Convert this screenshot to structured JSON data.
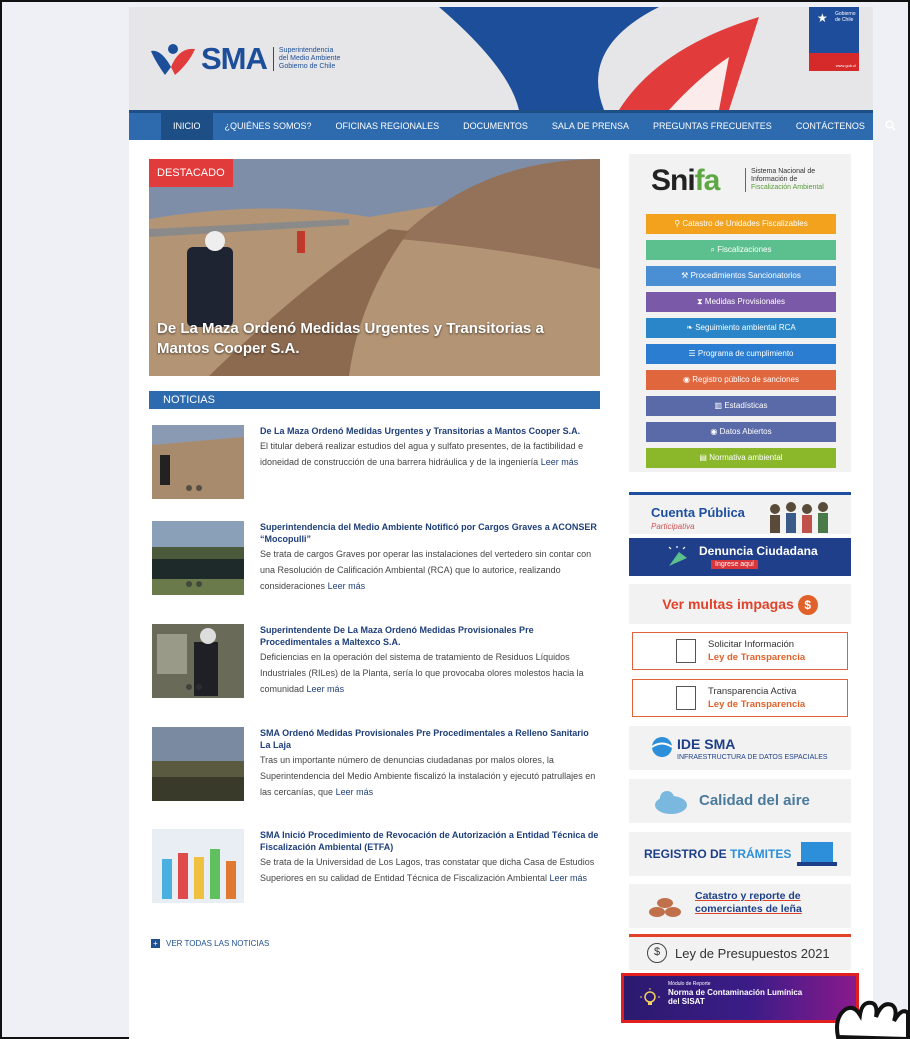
{
  "header": {
    "logo_text": "SMA",
    "logo_sub": [
      "Superintendencia",
      "del Medio Ambiente",
      "Gobierno de Chile"
    ],
    "gobierno": [
      "Gobierno",
      "de Chile"
    ],
    "gobierno_url": "www.gob.cl"
  },
  "nav": {
    "items": [
      "INICIO",
      "¿QUIÉNES SOMOS?",
      "OFICINAS REGIONALES",
      "DOCUMENTOS",
      "SALA DE PRENSA",
      "PREGUNTAS FRECUENTES",
      "CONTÁCTENOS"
    ],
    "search_icon": "search-icon"
  },
  "featured": {
    "badge": "DESTACADO",
    "title": "De La Maza Ordenó Medidas Urgentes y Transitorias a Mantos Cooper S.A."
  },
  "news": {
    "header": "NOTICIAS",
    "read_more": "Leer más",
    "items": [
      {
        "title": "De La Maza Ordenó Medidas Urgentes y Transitorias a Mantos Cooper S.A.",
        "body": "El titular deberá realizar estudios del agua y sulfato presentes, de la factibilidad e idoneidad de construcción de una barrera hidráulica y de la ingeniería"
      },
      {
        "title": "Superintendencia del Medio Ambiente Notificó por Cargos Graves a ACONSER “Mocopulli”",
        "body": "Se trata de cargos Graves por operar las instalaciones del vertedero sin contar con una Resolución de Calificación Ambiental (RCA) que lo autorice, realizando consideraciones"
      },
      {
        "title": "Superintendente De La Maza Ordenó Medidas Provisionales Pre Procedimentales a Maltexco S.A.",
        "body": "Deficiencias en la operación del sistema de tratamiento de Residuos Líquidos Industriales (RILes) de la Planta, sería lo que provocaba olores molestos hacia la comunidad"
      },
      {
        "title": "SMA Ordenó Medidas Provisionales Pre Procedimentales a Relleno Sanitario La Laja",
        "body": "Tras un importante número de denuncias ciudadanas por malos olores, la Superintendencia del Medio Ambiente fiscalizó la instalación y ejecutó patrullajes en las cercanías, que"
      },
      {
        "title": "SMA Inició Procedimiento de Revocación de Autorización a Entidad Técnica de Fiscalización Ambiental (ETFA)",
        "body": "Se trata de la Universidad de Los Lagos, tras constatar que dicha Casa de Estudios Superiores en su calidad de Entidad Técnica de Fiscalización Ambiental"
      }
    ],
    "see_all": "VER TODAS LAS NOTICIAS"
  },
  "snifa": {
    "logo_a": "Sni",
    "logo_b": "fa",
    "sub": [
      "Sistema Nacional de",
      "Información de",
      "Fiscalización Ambiental"
    ],
    "buttons": [
      {
        "label": "Catastro de Unidades Fiscalizables",
        "icon": "map-pin-icon",
        "color": "#f2a21c"
      },
      {
        "label": "Fiscalizaciones",
        "icon": "search-icon",
        "color": "#5cc08e"
      },
      {
        "label": "Procedimientos Sancionatorios",
        "icon": "gavel-icon",
        "color": "#4a8fd4"
      },
      {
        "label": "Medidas Provisionales",
        "icon": "hourglass-icon",
        "color": "#7a5aa8"
      },
      {
        "label": "Seguimiento ambiental RCA",
        "icon": "leaf-icon",
        "color": "#2a86c8"
      },
      {
        "label": "Programa de cumplimiento",
        "icon": "list-icon",
        "color": "#2a7dd0"
      },
      {
        "label": "Registro público de sanciones",
        "icon": "eye-icon",
        "color": "#e0663e"
      },
      {
        "label": "Estadísticas",
        "icon": "chart-icon",
        "color": "#5a6aa8"
      },
      {
        "label": "Datos Abiertos",
        "icon": "eye-icon",
        "color": "#5a6aa8"
      },
      {
        "label": "Normativa ambiental",
        "icon": "book-icon",
        "color": "#8ab82a"
      }
    ]
  },
  "banners": {
    "cuenta_title": "Cuenta Pública",
    "cuenta_sub": "Participativa",
    "denuncia_title": "Denuncia Ciudadana",
    "denuncia_sub": "Ingrese aquí",
    "multas": "Ver multas impagas",
    "solicitar_1": "Solicitar Información",
    "solicitar_2": "Ley de Transparencia",
    "transp_1": "Transparencia Activa",
    "transp_2": "Ley de Transparencia",
    "ide_title": "IDE SMA",
    "ide_sub": "INFRAESTRUCTURA DE DATOS ESPACIALES",
    "aire": "Calidad del aire",
    "tramites_a": "REGISTRO DE ",
    "tramites_b": "TRÁMITES",
    "lena_1": "Catastro y reporte de",
    "lena_2": "comerciantes de leña",
    "ley_presupuestos": "Ley de Presupuestos 2021",
    "sisat_small": "Módulo de Reporte",
    "sisat_1": "Norma de Contaminación Lumínica",
    "sisat_2": "del SISAT"
  }
}
